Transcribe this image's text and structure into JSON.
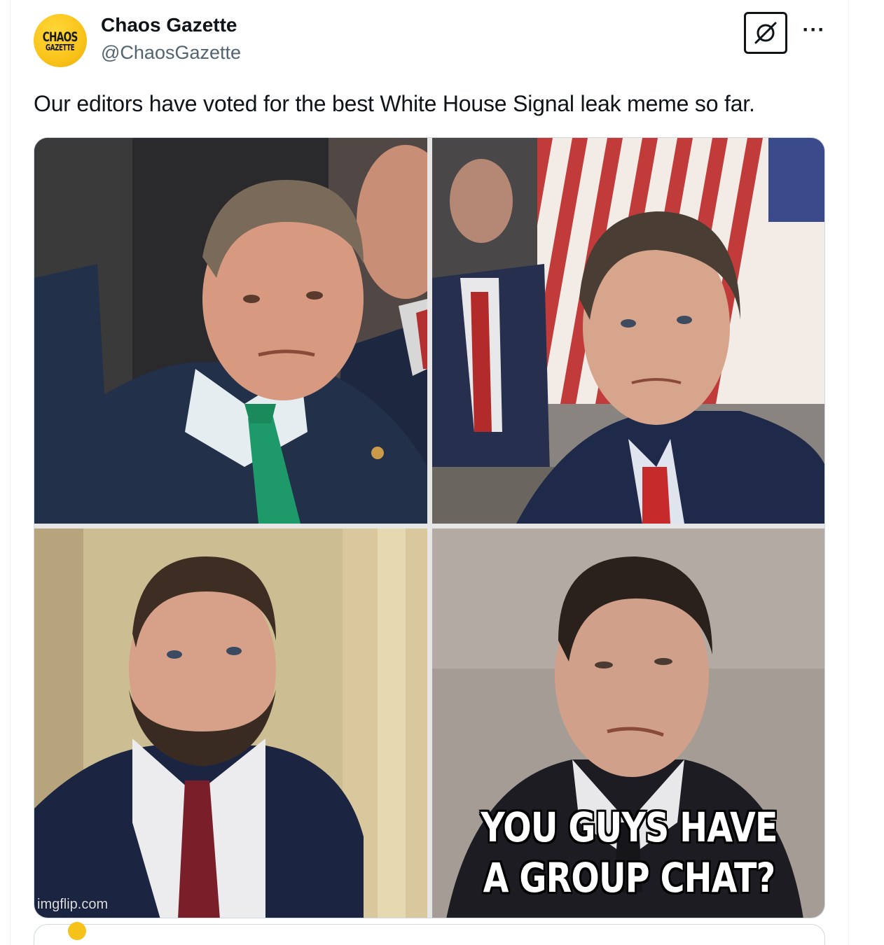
{
  "account": {
    "name": "Chaos Gazette",
    "handle": "@ChaosGazette",
    "avatar_line1": "CHAOS",
    "avatar_line2": "GAZETTE",
    "avatar_color": "#f9c31a"
  },
  "header_icons": {
    "grok_icon": "slashed-circle-icon",
    "more_icon": "more-dots-icon",
    "more_glyph": "···"
  },
  "tweet": {
    "text": "Our editors have voted for the best White House Signal leak meme so far."
  },
  "meme": {
    "caption_line1": "YOU GUYS HAVE",
    "caption_line2": "A GROUP CHAT?",
    "watermark": "imgflip.com",
    "panels": [
      "man-green-tie-photo",
      "man-flag-background-photo",
      "bearded-man-red-tie-photo",
      "man-squinting-photo"
    ]
  }
}
